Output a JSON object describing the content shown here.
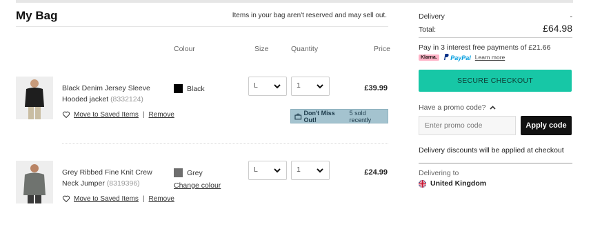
{
  "bag": {
    "title": "My Bag",
    "notice": "Items in your bag aren't reserved and may sell out."
  },
  "columns": {
    "colour": "Colour",
    "size": "Size",
    "quantity": "Quantity",
    "price": "Price"
  },
  "items": [
    {
      "name": "Black Denim Jersey Sleeve Hooded jacket",
      "code": "(8332124)",
      "colour_name": "Black",
      "colour_hex": "#000000",
      "size": "L",
      "quantity": "1",
      "price": "£39.99",
      "move_label": "Move to Saved Items",
      "remove_label": "Remove",
      "badge_strong": "Don't Miss Out!",
      "badge_text": "5 sold recently"
    },
    {
      "name": "Grey Ribbed Fine Knit Crew Neck Jumper",
      "code": "(8319396)",
      "colour_name": "Grey",
      "colour_hex": "#6e6e6e",
      "change_colour": "Change colour",
      "size": "L",
      "quantity": "1",
      "price": "£24.99",
      "move_label": "Move to Saved Items",
      "remove_label": "Remove"
    }
  ],
  "summary": {
    "delivery_label": "Delivery",
    "delivery_value": "-",
    "total_label": "Total:",
    "total_value": "£64.98",
    "klarna_text": "Pay in 3 interest free payments of £21.66",
    "klarna_badge": "Klarna.",
    "paypal_text": "PayPal",
    "learn_more": "Learn more",
    "checkout_label": "SECURE CHECKOUT",
    "promo_question": "Have a promo code?",
    "promo_placeholder": "Enter promo code",
    "apply_label": "Apply code",
    "discount_note": "Delivery discounts will be applied at checkout",
    "delivering_to_label": "Delivering to",
    "country": "United Kingdom"
  },
  "colors": {
    "checkout": "#17c7a6",
    "badge_bg": "#a4c3cf",
    "apply_bg": "#111111",
    "klarna_pink": "#ffb3c7"
  }
}
